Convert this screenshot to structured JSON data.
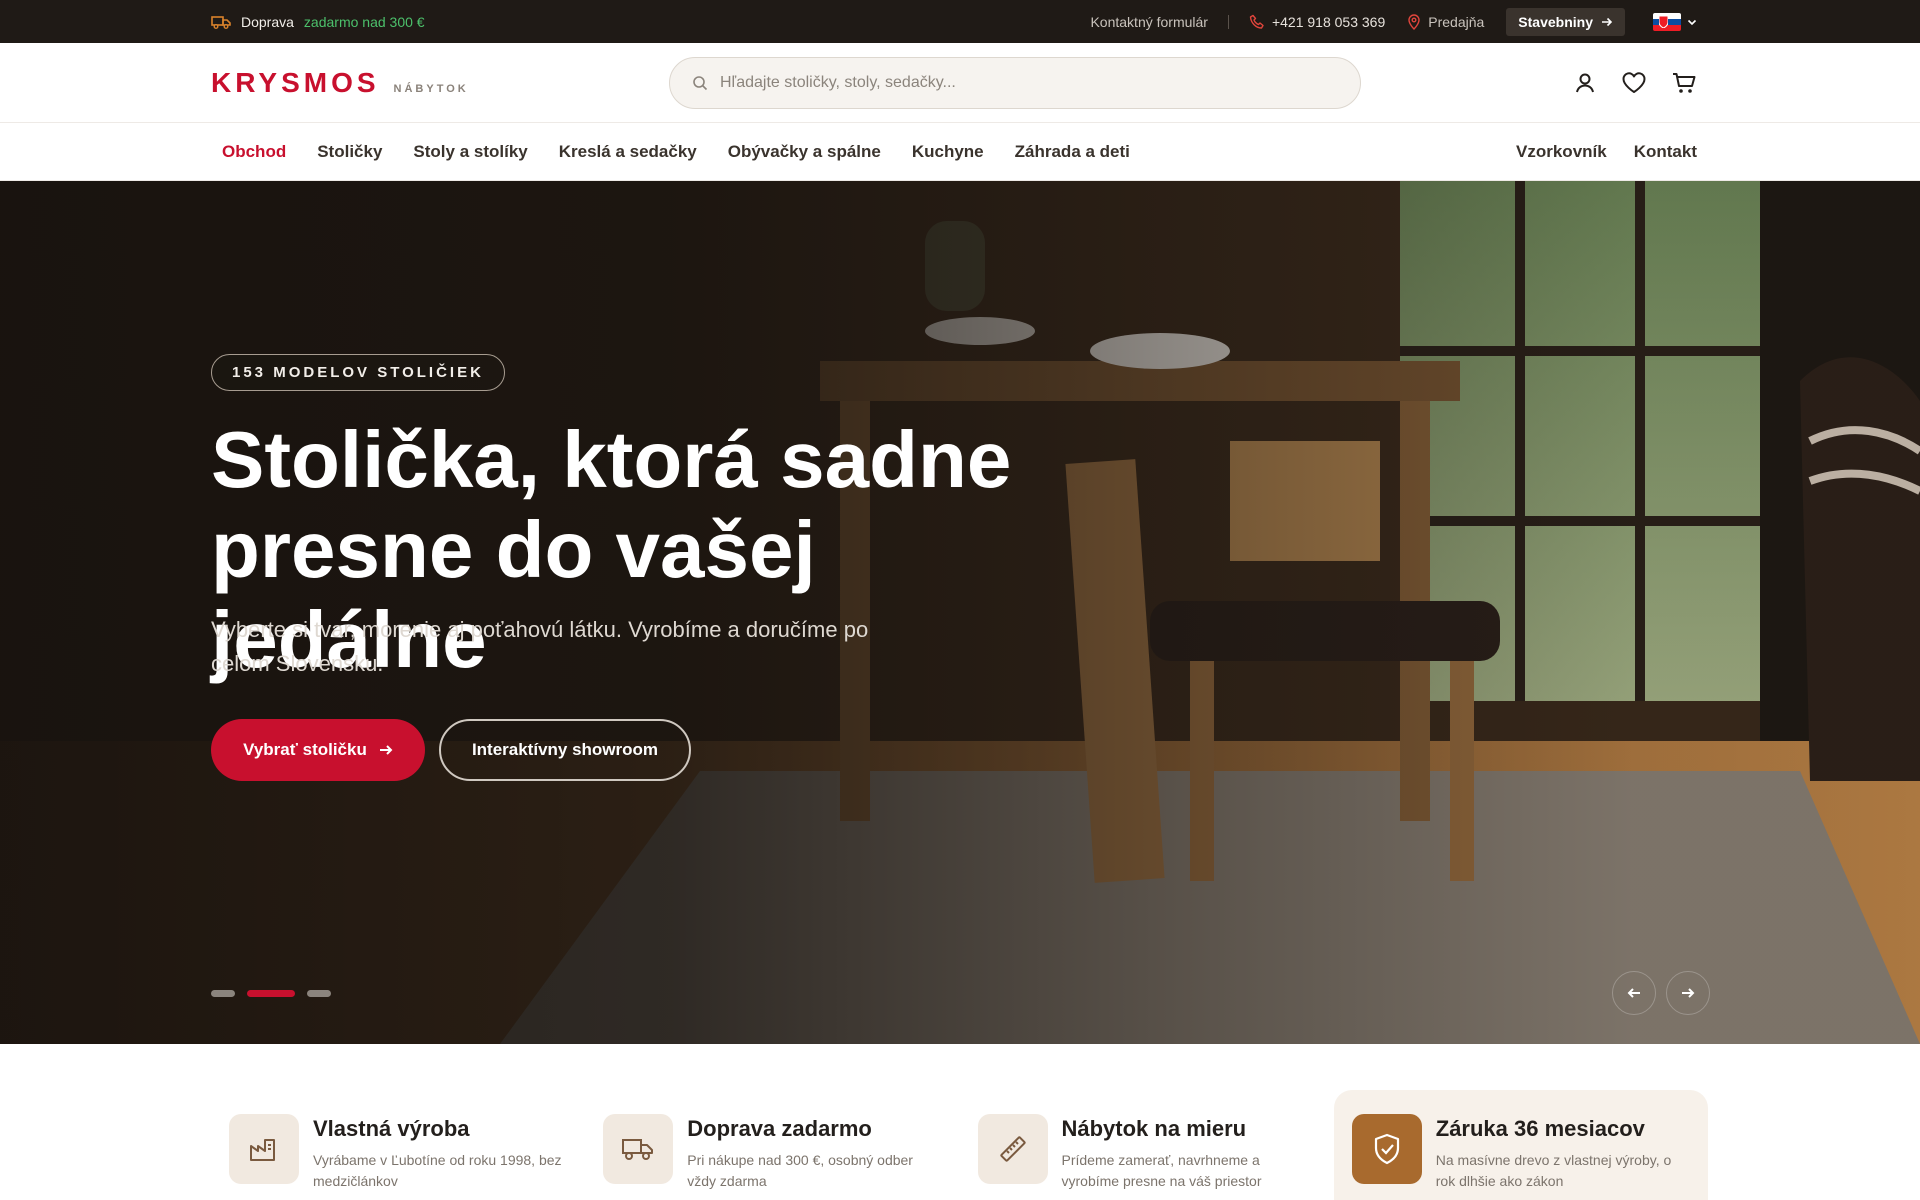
{
  "topbar": {
    "shipping_label": "Doprava",
    "shipping_free": "zadarmo nad 300 €",
    "contact_form": "Kontaktný formulár",
    "phone": "+421 918 053 369",
    "store": "Predajňa",
    "building_button": "Stavebniny",
    "language": "SK"
  },
  "header": {
    "logo_main": "KRYSMOS",
    "logo_sub": "NÁBYTOK",
    "search_placeholder": "Hľadajte stoličky, stoly, sedačky..."
  },
  "nav": {
    "items": [
      "Obchod",
      "Stoličky",
      "Stoly a stolíky",
      "Kreslá a sedačky",
      "Obývačky a spálne",
      "Kuchyne",
      "Záhrada a deti"
    ],
    "right_items": [
      "Vzorkovník",
      "Kontakt"
    ]
  },
  "hero": {
    "badge": "153 MODELOV STOLIČIEK",
    "title_line1": "Stolička, ktorá sadne",
    "title_line2": "presne do vašej jedálne",
    "subtitle": "Vyberte si tvar, morenie aj poťahovú látku. Vyrobíme a doručíme po celom Slovensku.",
    "primary_button": "Vybrať stoličku",
    "secondary_button": "Interaktívny showroom",
    "slide_count": 3,
    "active_slide": 2
  },
  "features": [
    {
      "title": "Vlastná výroba",
      "desc": "Vyrábame v Ľubotíne od roku 1998, bez medzičlánkov",
      "icon": "factory-icon"
    },
    {
      "title": "Doprava zadarmo",
      "desc": "Pri nákupe nad 300 €, osobný odber vždy zdarma",
      "icon": "truck-icon"
    },
    {
      "title": "Nábytok na mieru",
      "desc": "Prídeme zamerať, navrhneme a vyrobíme presne na váš priestor",
      "icon": "ruler-icon"
    },
    {
      "title": "Záruka 36 mesiacov",
      "desc": "Na masívne drevo z vlastnej výroby, o rok dlhšie ako zákon",
      "icon": "shield-icon"
    }
  ],
  "colors": {
    "accent": "#c8102e",
    "topbar": "#1f1a16",
    "free_shipping": "#4cc06b",
    "warranty_icon_bg": "#a86a2e"
  }
}
